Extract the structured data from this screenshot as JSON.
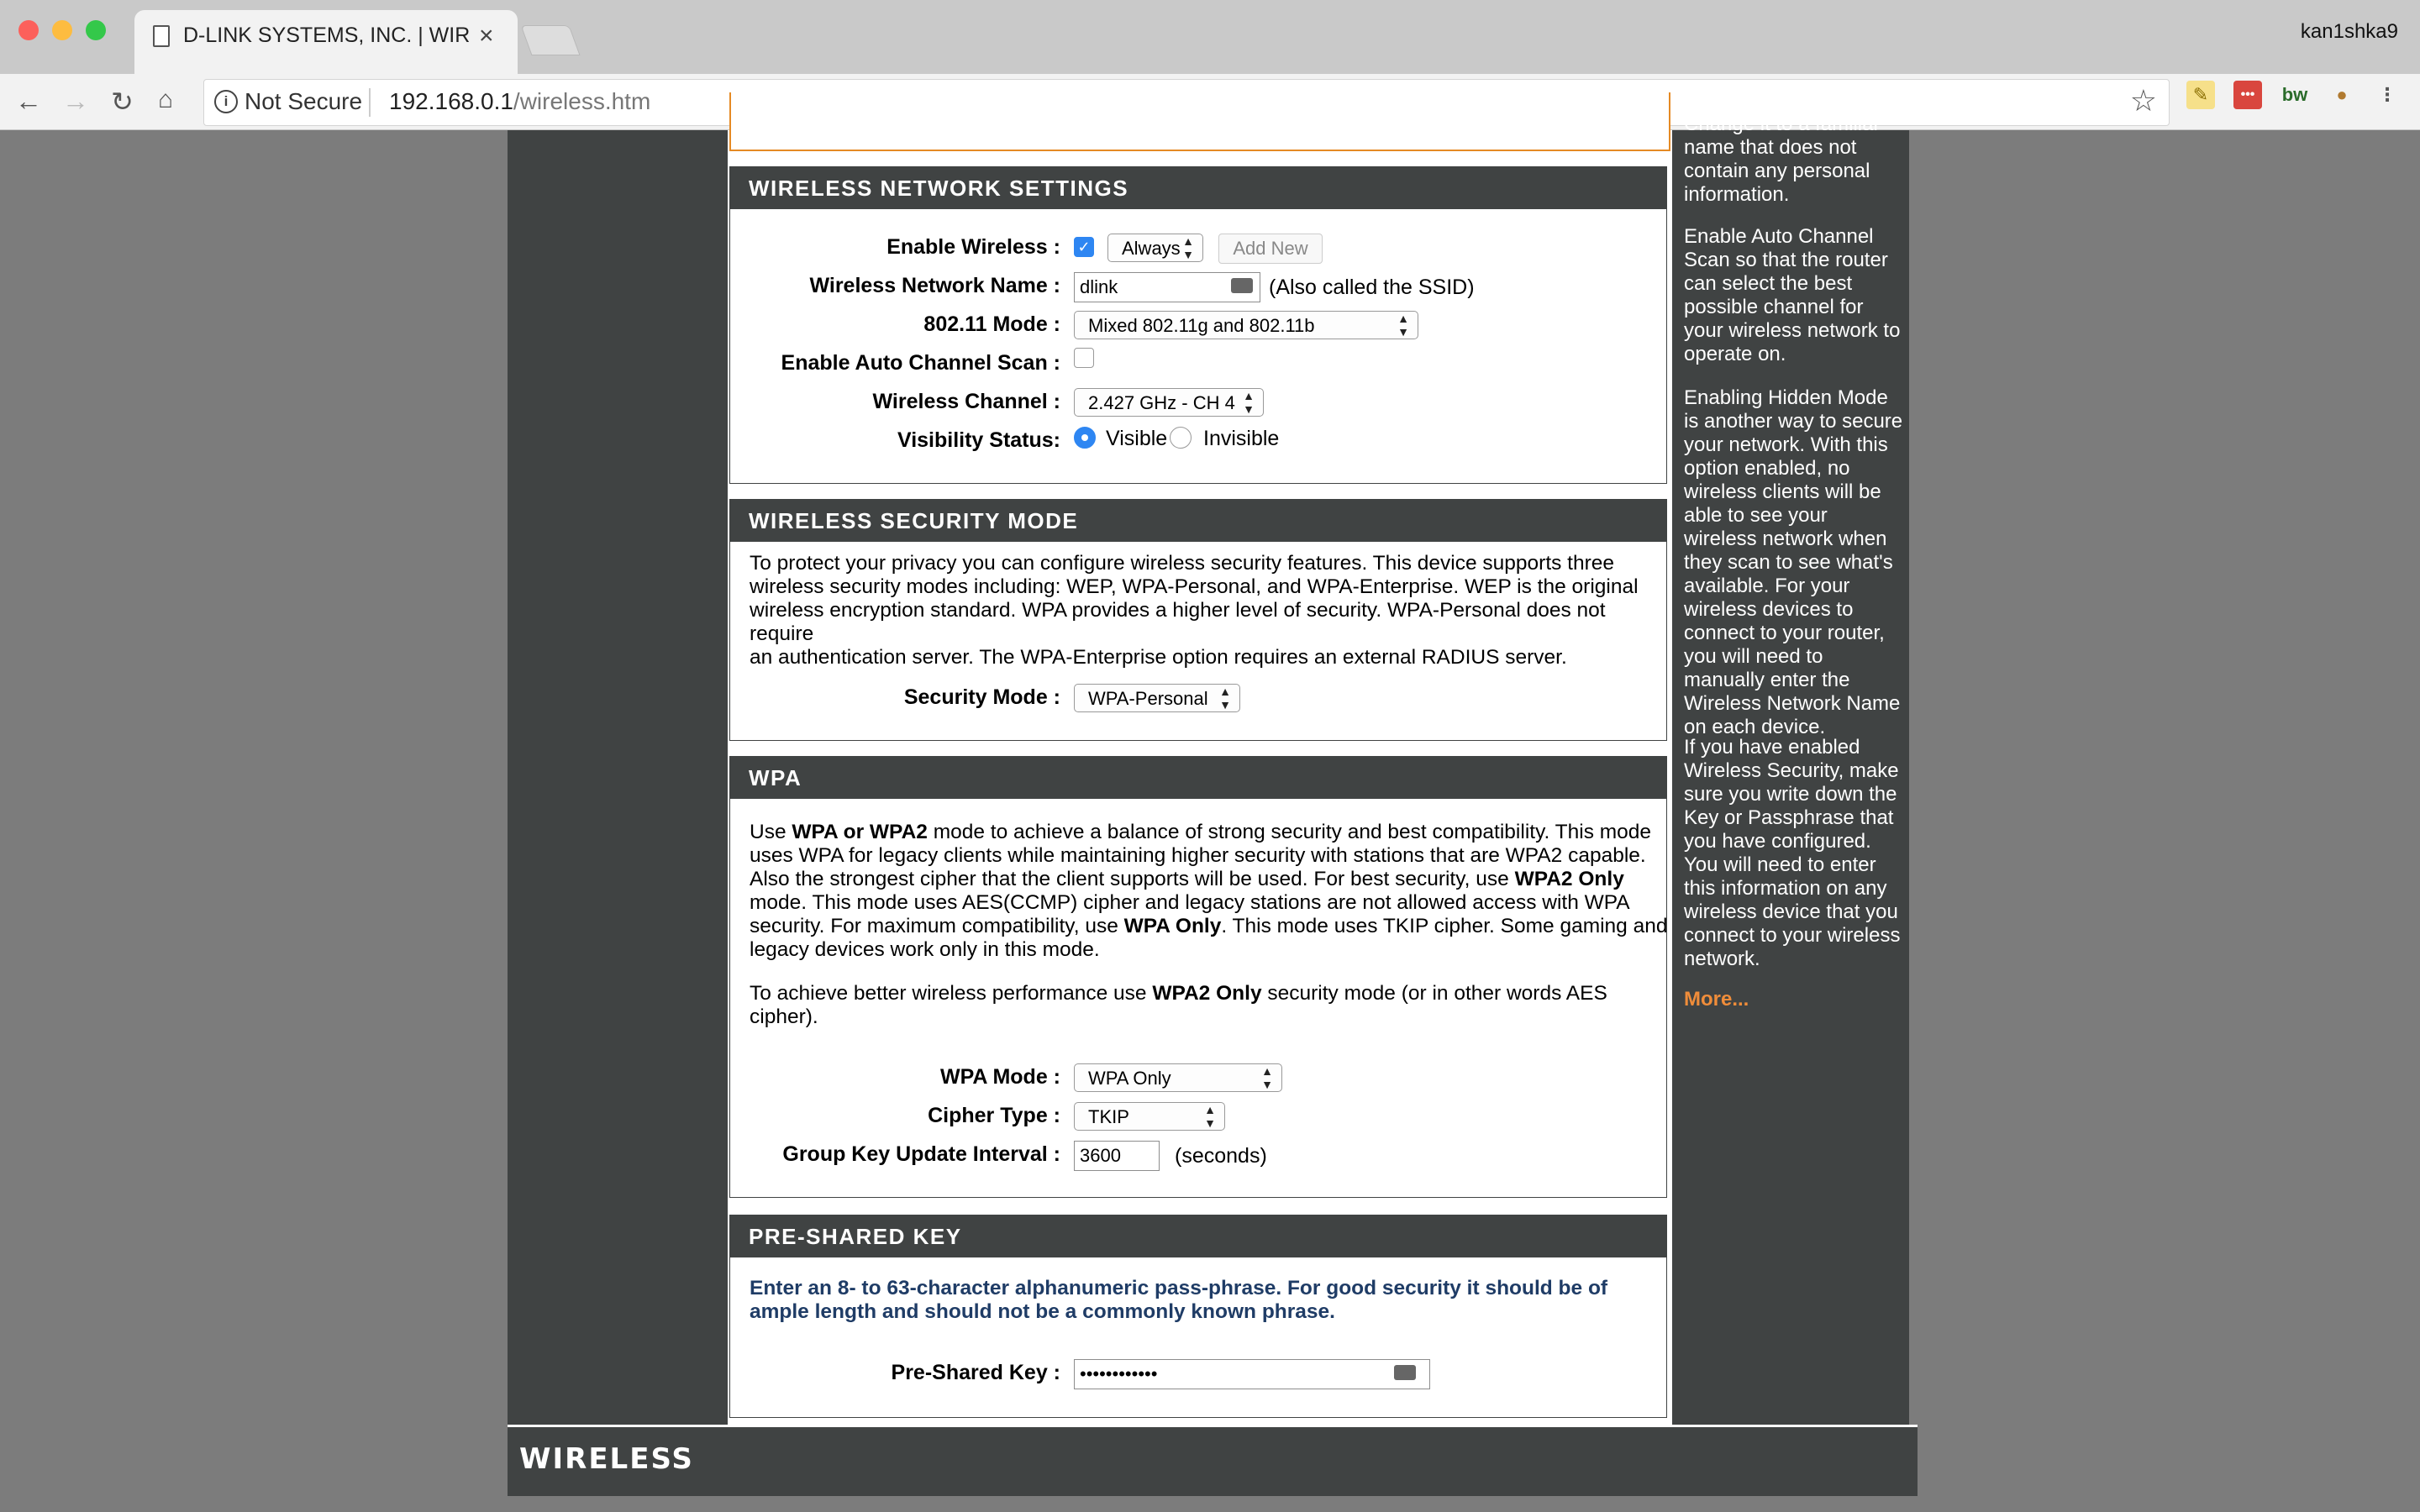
{
  "browser": {
    "tab_title": "D-LINK SYSTEMS, INC. | WIRELESS",
    "profile": "kan1shka9",
    "security_label": "Not Secure",
    "url_host": "192.168.0.1",
    "url_path": "/wireless.htm"
  },
  "wireless_network_settings": {
    "title": "WIRELESS NETWORK SETTINGS",
    "enable_wireless_label": "Enable Wireless :",
    "enable_wireless_checked": true,
    "schedule_value": "Always",
    "add_new_label": "Add New",
    "network_name_label": "Wireless Network Name :",
    "network_name_value": "dlink",
    "ssid_note": "(Also called the SSID)",
    "mode_label": "802.11 Mode :",
    "mode_value": "Mixed 802.11g and 802.11b",
    "auto_channel_label": "Enable Auto Channel Scan :",
    "auto_channel_checked": false,
    "channel_label": "Wireless Channel :",
    "channel_value": "2.427 GHz - CH 4",
    "visibility_label": "Visibility Status:",
    "visible_label": "Visible",
    "invisible_label": "Invisible",
    "visibility_selected": "Visible"
  },
  "wireless_security_mode": {
    "title": "WIRELESS SECURITY MODE",
    "description_lines": [
      "To protect your privacy you can configure wireless security features. This device supports three",
      "wireless security modes including: WEP, WPA-Personal, and WPA-Enterprise. WEP is the original",
      "wireless encryption standard. WPA provides a higher level of security. WPA-Personal does not require",
      "an authentication server. The WPA-Enterprise option requires an external RADIUS server."
    ],
    "security_mode_label": "Security Mode  :",
    "security_mode_value": "WPA-Personal"
  },
  "wpa": {
    "title": "WPA",
    "p1_line1_pre": "Use ",
    "p1_line1_bold": "WPA or WPA2",
    "p1_line1_post": " mode to achieve a balance of strong security and best compatibility. This mode",
    "p1_line2": "uses WPA for legacy clients while maintaining higher security with stations that are WPA2 capable.",
    "p1_line3_pre": "Also the strongest cipher that the client supports will be used. For best security, use ",
    "p1_line3_bold": "WPA2 Only",
    "p1_line4": "mode. This mode uses AES(CCMP) cipher and legacy stations are not allowed access with WPA",
    "p1_line5_pre": "security. For maximum compatibility, use ",
    "p1_line5_bold": "WPA Only",
    "p1_line5_post": ". This mode uses TKIP cipher. Some gaming and",
    "p1_line6": "legacy devices work only in this mode.",
    "p2_line1_pre": "To achieve better wireless performance use ",
    "p2_line1_bold": "WPA2 Only",
    "p2_line1_post": " security mode (or in other words AES",
    "p2_line2": "cipher).",
    "wpa_mode_label": "WPA Mode :",
    "wpa_mode_value": "WPA Only",
    "cipher_label": "Cipher Type :",
    "cipher_value": "TKIP",
    "interval_label": "Group Key Update Interval :",
    "interval_value": "3600",
    "interval_unit": "(seconds)"
  },
  "pre_shared_key": {
    "title": "PRE-SHARED KEY",
    "hint_line1": "Enter an 8- to 63-character alphanumeric pass-phrase. For good security it should be of",
    "hint_line2": "ample length and should not be a commonly known phrase.",
    "key_label": "Pre-Shared Key :",
    "key_value": "••••••••••••"
  },
  "help": {
    "p0": "Change it to a familiar name that does not contain any personal information.",
    "p1": "Enable Auto Channel Scan so that the router can select the best possible channel for your wireless network to operate on.",
    "p2": "Enabling Hidden Mode is another way to secure your network. With this option enabled, no wireless clients will be able to see your wireless network when they scan to see what's available. For your wireless devices to connect to your router, you will need to manually enter the Wireless Network Name on each device.",
    "p3": "If you have enabled Wireless Security, make sure you write down the Key or Passphrase that you have configured. You will need to enter this information on any wireless device that you connect to your wireless network.",
    "more": "More..."
  },
  "footer": {
    "logo": "WIRELESS"
  },
  "colors": {
    "panel": "#404343",
    "accent_orange": "#e58a24",
    "hint_blue": "#1f3c66",
    "check_blue": "#2e86f2"
  }
}
